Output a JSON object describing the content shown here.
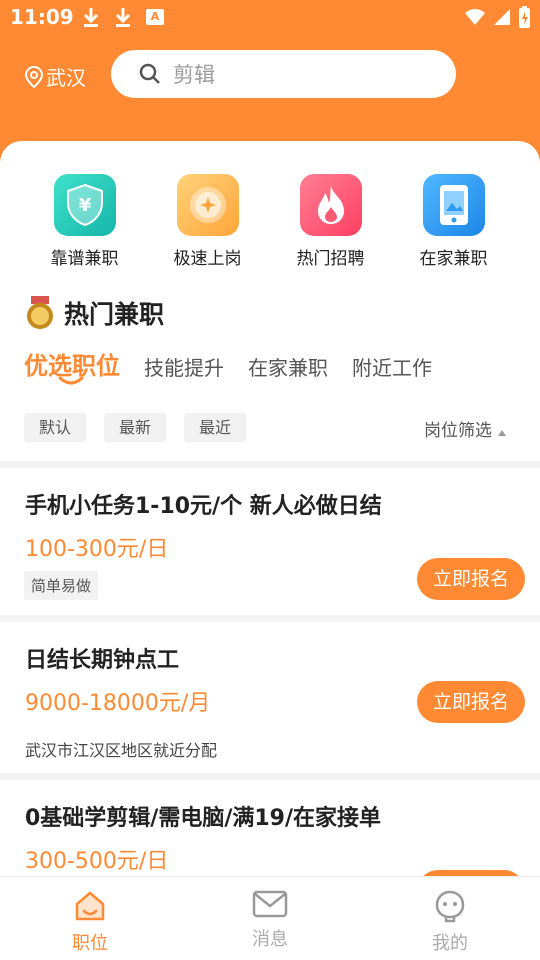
{
  "status_bar": {
    "time": "11:09"
  },
  "header": {
    "location": "武汉",
    "search_placeholder": "剪辑"
  },
  "categories": [
    {
      "label": "靠谱兼职",
      "icon": "shield-yen-icon",
      "color": "#22c7b8"
    },
    {
      "label": "极速上岗",
      "icon": "coin-icon",
      "color": "#ffb84d"
    },
    {
      "label": "热门招聘",
      "icon": "fire-icon",
      "color": "#ff5a73"
    },
    {
      "label": "在家兼职",
      "icon": "phone-icon",
      "color": "#2d9bf0"
    }
  ],
  "section": {
    "title": "热门兼职"
  },
  "tabs": [
    {
      "label": "优选职位",
      "active": true
    },
    {
      "label": "技能提升",
      "active": false
    },
    {
      "label": "在家兼职",
      "active": false
    },
    {
      "label": "附近工作",
      "active": false
    }
  ],
  "filters": {
    "chips": [
      "默认",
      "最新",
      "最近"
    ],
    "right": "岗位筛选"
  },
  "jobs": [
    {
      "title": "手机小任务1-10元/个 新人必做日结",
      "salary": "100-300元/日",
      "tag": "简单易做",
      "button": "立即报名"
    },
    {
      "title": "日结长期钟点工",
      "salary": "9000-18000元/月",
      "address": "武汉市江汉区地区就近分配",
      "button": "立即报名"
    },
    {
      "title": "0基础学剪辑/需电脑/满19/在家接单",
      "salary": "300-500元/日"
    }
  ],
  "bottom_nav": [
    {
      "label": "职位",
      "icon": "home-icon",
      "active": true
    },
    {
      "label": "消息",
      "icon": "mail-icon",
      "active": false
    },
    {
      "label": "我的",
      "icon": "profile-icon",
      "active": false
    }
  ],
  "colors": {
    "accent": "#ff8a33",
    "text": "#222222",
    "muted": "#aaaaaa"
  }
}
